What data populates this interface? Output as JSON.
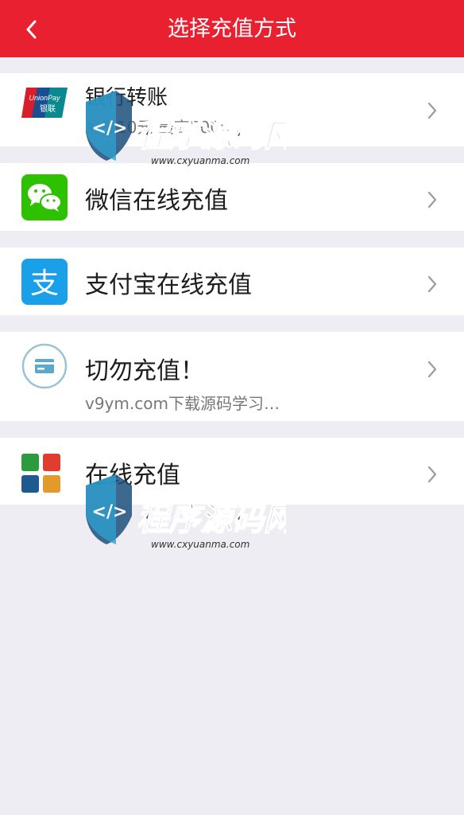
{
  "header": {
    "title": "选择充值方式"
  },
  "items": [
    {
      "label": "银行转账",
      "sub": "最低10元    最高5000…",
      "icon": "unionpay-icon",
      "logo_top": "UnionPay",
      "logo_bottom": "银联"
    },
    {
      "label": "微信在线充值",
      "icon": "wechat-icon"
    },
    {
      "label": "支付宝在线充值",
      "icon": "alipay-icon",
      "glyph": "支"
    },
    {
      "label": "切勿充值！",
      "sub": "v9ym.com下载源码学习…",
      "icon": "card-icon"
    },
    {
      "label": "在线充值",
      "icon": "tiles-icon"
    }
  ],
  "watermark": {
    "title": "程序源码网",
    "url": "www.cxyuanma.com"
  },
  "colors": {
    "header": "#e8202f",
    "wechat": "#2dc100",
    "alipay": "#1aa0e8",
    "background": "#eeedf3"
  }
}
